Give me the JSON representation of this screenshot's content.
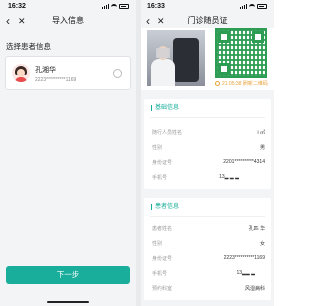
{
  "left": {
    "status": {
      "time": "16:32"
    },
    "nav": {
      "back": "‹",
      "close": "✕",
      "title": "导入信息"
    },
    "section_label": "选择患者信息",
    "patient": {
      "name": "孔湘华",
      "id_masked": "2223**********1169"
    },
    "next_button": "下一步"
  },
  "right": {
    "status": {
      "time": "16:33"
    },
    "nav": {
      "back": "‹",
      "close": "✕",
      "title": "门诊随员证"
    },
    "qr_time": "21:05:38 刷新二维码",
    "basic_info": {
      "title": "基础信息",
      "rows": [
        {
          "label": "随行人员姓名",
          "value": "i ㎡"
        },
        {
          "label": "性别",
          "value": "男"
        },
        {
          "label": "身份证号",
          "value": "2201**********4314"
        },
        {
          "label": "手机号",
          "value": "13▂ ▂ ▂"
        }
      ]
    },
    "patient_info": {
      "title": "患者信息",
      "rows": [
        {
          "label": "患者姓名",
          "value": "孔匹 华"
        },
        {
          "label": "性别",
          "value": "女"
        },
        {
          "label": "身份证号",
          "value": "2223**********1169"
        },
        {
          "label": "手机号",
          "value": "13▂▂ ▂"
        },
        {
          "label": "预约科室",
          "value": "风湿病科"
        }
      ]
    }
  },
  "colors": {
    "accent": "#19ae9b",
    "qr": "#2e9d54",
    "warning": "#e6a23c"
  },
  "icons": [
    "back-icon",
    "close-icon",
    "radio-icon",
    "clock-icon"
  ]
}
